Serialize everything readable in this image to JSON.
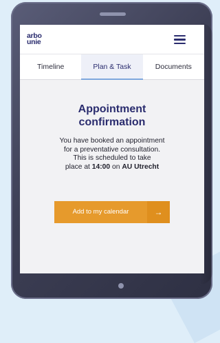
{
  "app": {
    "logo_line1": "arbo",
    "logo_line2": "unie"
  },
  "tabs": [
    {
      "label": "Timeline",
      "active": false
    },
    {
      "label": "Plan & Task",
      "active": true
    },
    {
      "label": "Documents",
      "active": false
    }
  ],
  "main": {
    "title": "Appointment confirmation",
    "desc_line1": "You have booked an appointment",
    "desc_line2": "for a preventative consultation.",
    "desc_line3": "This is scheduled to take",
    "desc_place_at": "place at",
    "time": "14:00",
    "desc_on": "on",
    "location": "AU Utrecht",
    "cta_label": "Add to my calendar",
    "cta_arrow": "→"
  },
  "icons": {
    "menu": "hamburger-menu-icon",
    "arrow": "arrow-right-icon"
  },
  "colors": {
    "brand_navy": "#2a2c6e",
    "accent_orange": "#e69a2c",
    "accent_orange_dark": "#df8f1e",
    "tab_active_underline": "#7da7de",
    "device_frame": "#3d3f55",
    "background": "#dfeef9"
  }
}
